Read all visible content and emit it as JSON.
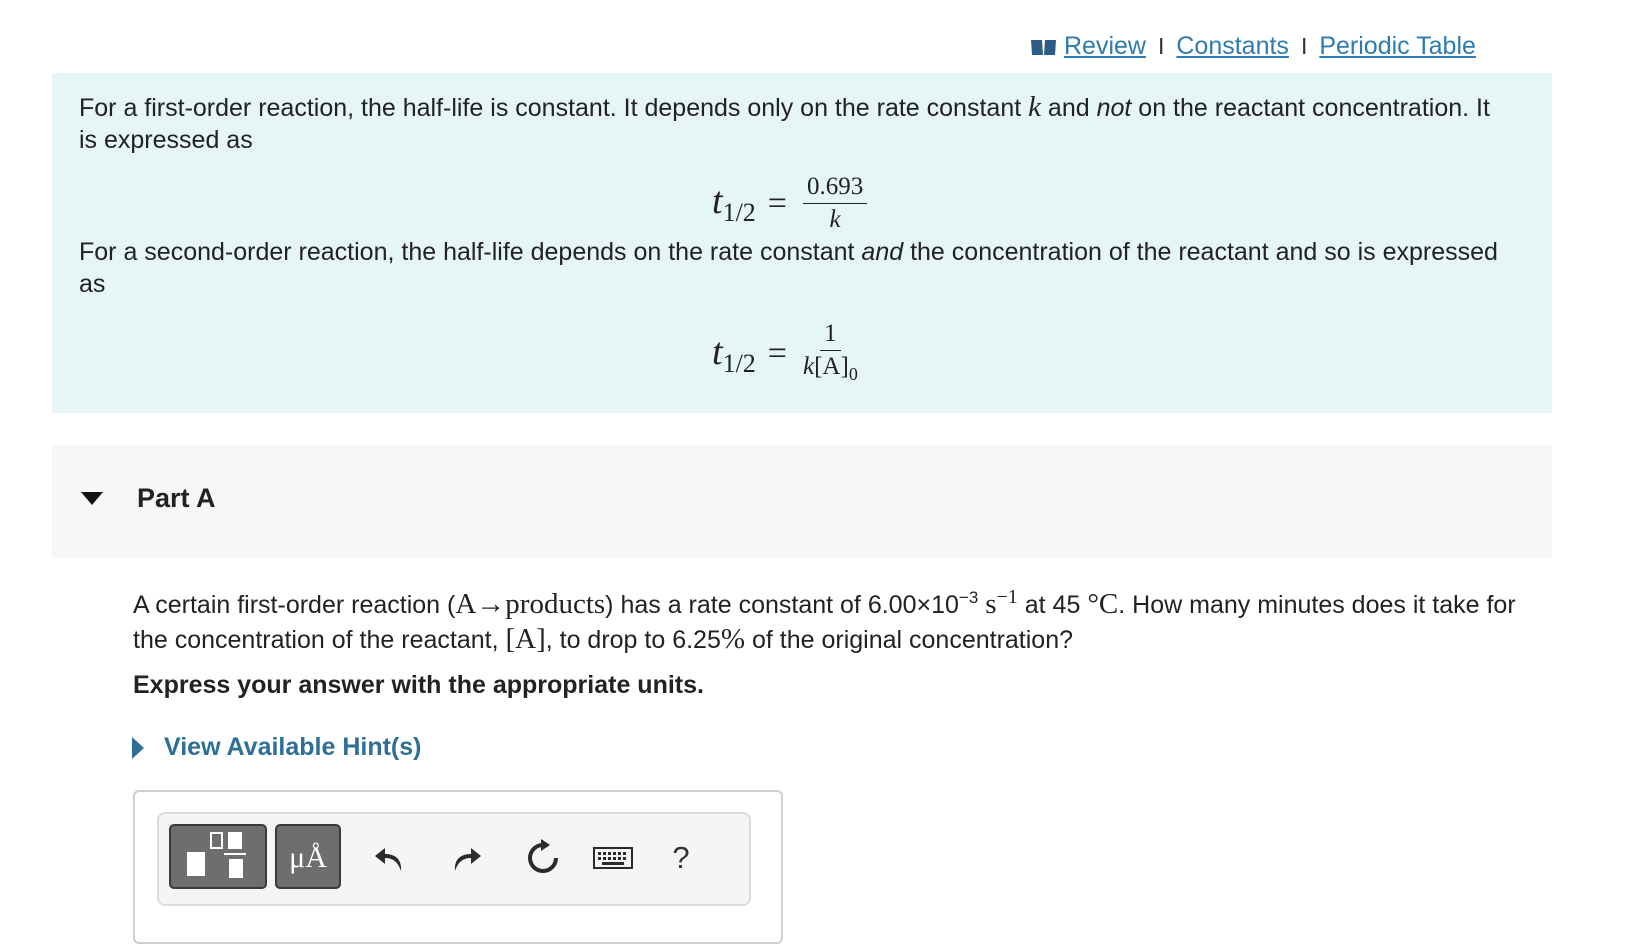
{
  "top_links": {
    "review": "Review",
    "separator": "I",
    "constants": "Constants",
    "periodic_table": "Periodic Table"
  },
  "intro": {
    "p1_part1": "For a first-order reaction, the half-life is constant. It depends only on the rate constant ",
    "p1_k": "k",
    "p1_part2": " and ",
    "p1_not": "not",
    "p1_part3": " on the reactant concentration.  It is expressed as",
    "p2_part1": "For a second-order reaction, the half-life depends on the rate constant ",
    "p2_and": "and",
    "p2_part2": " the concentration of the reactant  and so is expressed as",
    "formula1": {
      "lhs": "t",
      "lhs_sub": "1/2",
      "eq": "=",
      "numerator": "0.693",
      "denominator": "k"
    },
    "formula2": {
      "lhs": "t",
      "lhs_sub": "1/2",
      "eq": "=",
      "numerator": "1",
      "den_k": "k",
      "den_conc": "[A]",
      "den_sub": "0"
    }
  },
  "part": {
    "title": "Part A"
  },
  "question": {
    "t1": "A certain first-order reaction (",
    "reaction": "A→products",
    "t2": ") has a rate constant of 6.00×10",
    "exp": "−3",
    "unit": "s",
    "unit_exp": "−1",
    "t3": " at 45 ",
    "temp_unit": "°C",
    "t4": ". How many minutes does it take for the concentration of the reactant, ",
    "conc": "[A]",
    "t5": ", to drop to 6.25",
    "percent": "%",
    "t6": " of the original concentration?"
  },
  "instruction": "Express your answer with the appropriate units.",
  "hints_label": "View Available Hint(s)",
  "toolbar": {
    "units_label": "μÅ",
    "help_label": "?"
  },
  "icons": {
    "book": "book-icon",
    "undo": "undo-icon",
    "redo": "redo-icon",
    "reset": "reset-icon",
    "keyboard": "keyboard-icon",
    "templates": "templates-icon"
  }
}
